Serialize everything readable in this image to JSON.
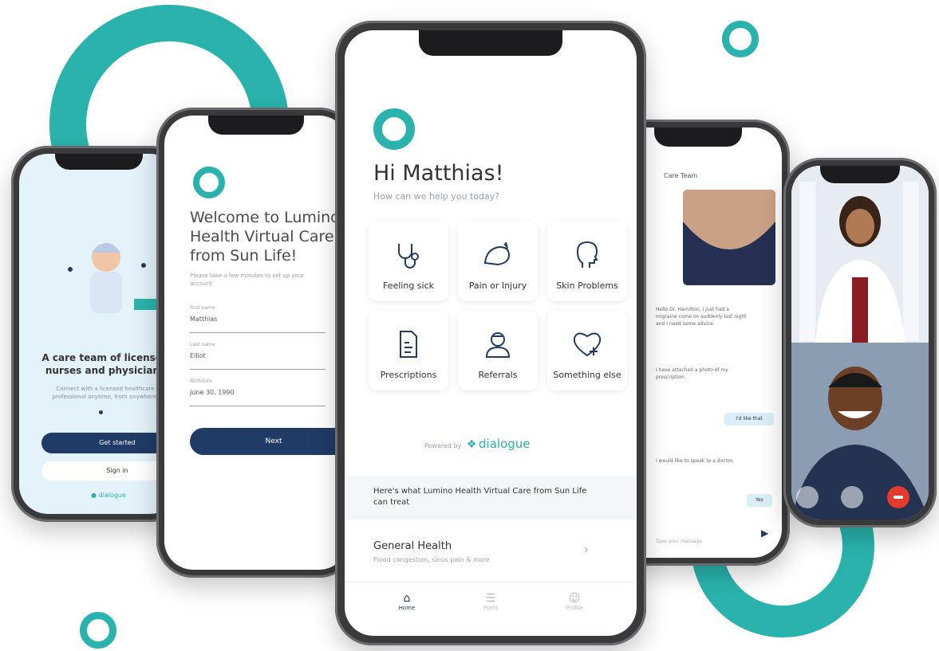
{
  "brand": {
    "accent": "#2ab3ad",
    "navy": "#1f3b66",
    "bubble": "#d9eef7"
  },
  "center": {
    "greeting": "Hi Matthias!",
    "subtitle": "How can we help you today?",
    "tiles": [
      {
        "label": "Feeling sick",
        "icon": "stethoscope-icon"
      },
      {
        "label": "Pain or Injury",
        "icon": "bandaged-arm-icon"
      },
      {
        "label": "Skin Problems",
        "icon": "face-profile-icon"
      },
      {
        "label": "Prescriptions",
        "icon": "prescription-icon"
      },
      {
        "label": "Referrals",
        "icon": "doctor-icon"
      },
      {
        "label": "Something else",
        "icon": "heart-plus-icon"
      }
    ],
    "powered_by": "Powered by",
    "partner": "dialogue",
    "treat_text": "Here's what Lumino Health Virtual Care from Sun Life can treat",
    "card_title": "General Health",
    "card_sub": "Flood congestion, sinus pain & more",
    "nav": [
      "Home",
      "Plans",
      "Profile"
    ]
  },
  "welcome": {
    "title": "Welcome to Lumino Health Virtual Care from Sun Life!",
    "intro": "Please take a few minutes to set up your account",
    "fields": [
      {
        "label": "First name",
        "value": "Matthias"
      },
      {
        "label": "Last name",
        "value": "Elliot"
      },
      {
        "label": "Birthdate",
        "value": "June 30, 1990"
      }
    ],
    "button": "Next"
  },
  "left": {
    "headline": "A care team of licensed nurses and physicians",
    "body": "Connect with a licensed healthcare professional anytime, from anywhere.",
    "primary": "Get started",
    "secondary": "Sign in",
    "partner": "dialogue"
  },
  "chat": {
    "header": "Care Team",
    "msg1": "Hello Dr. Hamilton, I just had a migraine come on suddenly last night and I need some advice.",
    "msg2": "I have attached a photo of my prescription.",
    "reply1": "I'd like that",
    "msg3": "I would like to speak to a doctor.",
    "reply2": "Yes",
    "placeholder": "Type your message"
  },
  "video": {
    "end_color": "#e23b2e"
  }
}
